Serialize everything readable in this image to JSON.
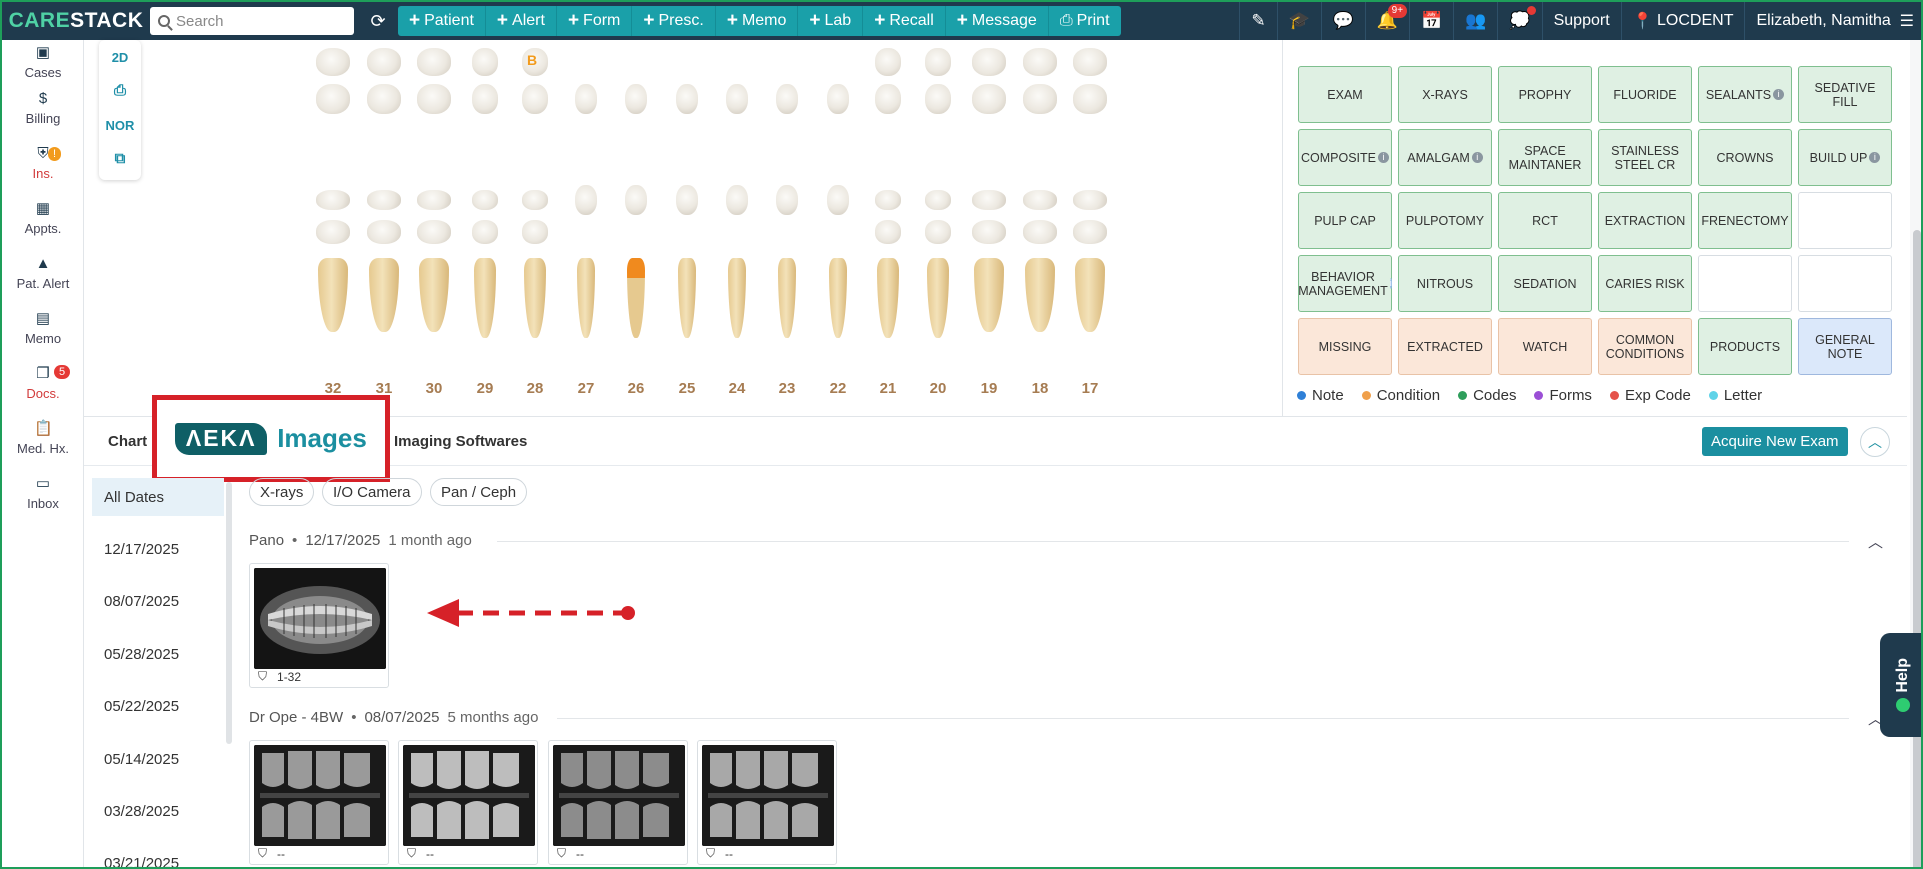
{
  "app": {
    "logo": "CARESTACK"
  },
  "topbar": {
    "search_placeholder": "Search",
    "actions": [
      "Patient",
      "Alert",
      "Form",
      "Presc.",
      "Memo",
      "Lab",
      "Recall",
      "Message"
    ],
    "print_label": "Print",
    "notif_badge": "9+",
    "support_label": "Support",
    "location": "LOCDENT",
    "user": "Elizabeth, Namitha"
  },
  "leftnav": {
    "items": [
      {
        "label": "Cases",
        "icon": "case-icon"
      },
      {
        "label": "Billing",
        "icon": "billing-icon"
      },
      {
        "label": "Ins.",
        "icon": "insurance-icon",
        "badge": "!"
      },
      {
        "label": "Appts.",
        "icon": "calendar-icon"
      },
      {
        "label": "Pat. Alert",
        "icon": "alert-triangle-icon"
      },
      {
        "label": "Memo",
        "icon": "memo-icon"
      },
      {
        "label": "Docs.",
        "icon": "documents-icon",
        "badge": "5"
      },
      {
        "label": "Med. Hx.",
        "icon": "clipboard-icon"
      },
      {
        "label": "Inbox",
        "icon": "inbox-icon"
      }
    ]
  },
  "chart_tools": [
    "2D",
    "NOR"
  ],
  "tooth_numbers": [
    "32",
    "31",
    "30",
    "29",
    "28",
    "27",
    "26",
    "25",
    "24",
    "23",
    "22",
    "21",
    "20",
    "19",
    "18",
    "17"
  ],
  "tooth_mark": "B",
  "procedures": [
    [
      "EXAM",
      "X-RAYS",
      "PROPHY",
      "FLUORIDE",
      "SEALANTS",
      "SEDATIVE FILL"
    ],
    [
      "COMPOSITE",
      "AMALGAM",
      "SPACE MAINTANER",
      "STAINLESS STEEL CR",
      "CROWNS",
      "BUILD UP"
    ],
    [
      "PULP CAP",
      "PULPOTOMY",
      "RCT",
      "EXTRACTION",
      "FRENECTOMY",
      ""
    ],
    [
      "BEHAVIOR MANAGEMENT",
      "NITROUS",
      "SEDATION",
      "CARIES RISK",
      "",
      ""
    ],
    [
      "MISSING",
      "EXTRACTED",
      "WATCH",
      "COMMON CONDITIONS",
      "PRODUCTS",
      "GENERAL NOTE"
    ]
  ],
  "legend": [
    {
      "label": "Note",
      "color": "#2f80d7"
    },
    {
      "label": "Condition",
      "color": "#f0a04b"
    },
    {
      "label": "Codes",
      "color": "#2e9e5b"
    },
    {
      "label": "Forms",
      "color": "#9b4fd6"
    },
    {
      "label": "Exp Code",
      "color": "#e5534b"
    },
    {
      "label": "Letter",
      "color": "#5fd3e8"
    }
  ],
  "tabs": {
    "chart": "Chart",
    "imaging": "Imaging Softwares",
    "acquire": "Acquire New Exam"
  },
  "aeka": {
    "mark": "ΛEKΛ",
    "text": "Images"
  },
  "dates": [
    "All Dates",
    "12/17/2025",
    "08/07/2025",
    "05/28/2025",
    "05/22/2025",
    "05/14/2025",
    "03/28/2025",
    "03/21/2025"
  ],
  "filters": [
    "X-rays",
    "I/O Camera",
    "Pan / Ceph"
  ],
  "exams": [
    {
      "name": "Pano",
      "date": "12/17/2025",
      "ago": "1 month ago",
      "images": [
        "1-32"
      ]
    },
    {
      "name": "Dr Ope - 4BW",
      "date": "08/07/2025",
      "ago": "5 months ago",
      "images": [
        "--",
        "--",
        "--",
        "--"
      ]
    }
  ],
  "help": "Help"
}
